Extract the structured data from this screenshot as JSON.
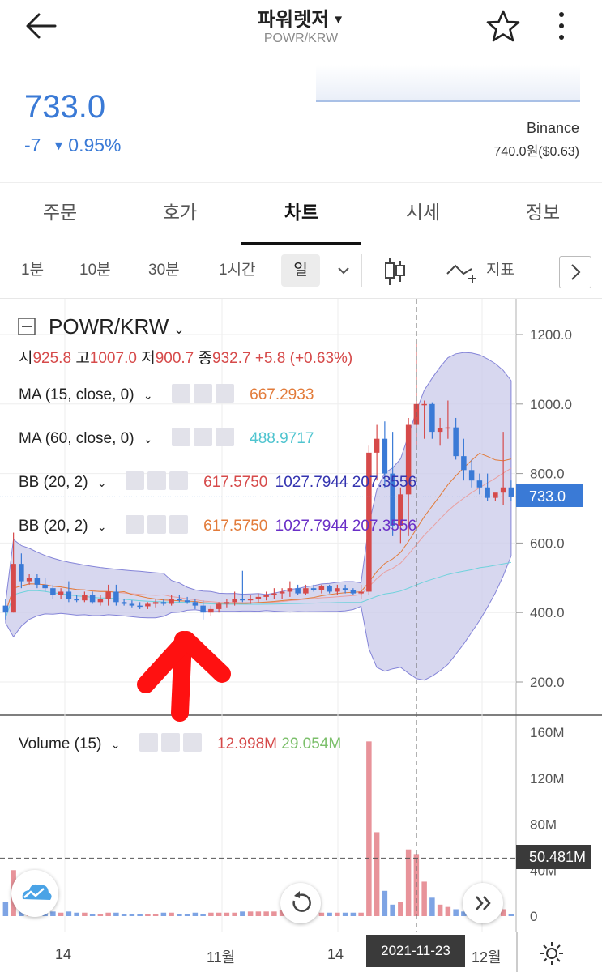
{
  "header": {
    "title": "파워렛저",
    "pair": "POWR/KRW"
  },
  "quote": {
    "price": "733.0",
    "change": "-7",
    "change_pct": "0.95%",
    "exchange": "Binance",
    "exchange_price": "740.0원($0.63)",
    "color_down": "#3a7ad6",
    "color_up": "#d64a4a"
  },
  "tabs": [
    "주문",
    "호가",
    "차트",
    "시세",
    "정보"
  ],
  "active_tab": "차트",
  "toolbar": {
    "intervals": [
      "1분",
      "10분",
      "30분",
      "1시간"
    ],
    "selected": "일",
    "indicator_label": "지표"
  },
  "legend": {
    "symbol": "POWR/KRW",
    "ohlc": {
      "o_label": "시",
      "o": "925.8",
      "h_label": "고",
      "h": "1007.0",
      "l_label": "저",
      "l": "900.7",
      "c_label": "종",
      "c": "932.7",
      "chg": "+5.8 (+0.63%)"
    },
    "ma15": {
      "label": "MA (15, close, 0)",
      "value": "667.2933",
      "color": "#e27b3a"
    },
    "ma60": {
      "label": "MA (60, close, 0)",
      "value": "488.9717",
      "color": "#4fc4cf"
    },
    "bb1": {
      "label": "BB (20, 2)",
      "mid": "617.5750",
      "upper": "1027.7944",
      "lower": "207.3556"
    },
    "bb2": {
      "label": "BB (20, 2)",
      "mid": "617.5750",
      "upper": "1027.7944",
      "lower": "207.3556"
    },
    "volume": {
      "label": "Volume (15)",
      "v1": "12.998M",
      "v2": "29.054M"
    }
  },
  "axes": {
    "price_ticks": [
      "1200.0",
      "1000.0",
      "800.0",
      "600.0",
      "400.0",
      "200.0"
    ],
    "price_current": "733.0",
    "volume_ticks": [
      "160M",
      "120M",
      "80M",
      "40M",
      "0"
    ],
    "volume_current": "50.481M",
    "x_ticks": [
      "14",
      "11월",
      "14",
      "12월"
    ],
    "crosshair_date": "2021-11-23"
  },
  "chart_data": {
    "type": "candlestick",
    "price_range": [
      100,
      1300
    ],
    "volume_range": [
      0,
      170
    ],
    "crosshair_price_line": 733.0,
    "volume_line": 50.481,
    "candles": [
      [
        420,
        440,
        380,
        400
      ],
      [
        400,
        630,
        400,
        540
      ],
      [
        540,
        570,
        470,
        490
      ],
      [
        490,
        510,
        480,
        500
      ],
      [
        500,
        510,
        470,
        480
      ],
      [
        480,
        500,
        460,
        470
      ],
      [
        470,
        480,
        440,
        450
      ],
      [
        450,
        470,
        440,
        460
      ],
      [
        460,
        490,
        430,
        440
      ],
      [
        440,
        450,
        430,
        435
      ],
      [
        435,
        460,
        430,
        450
      ],
      [
        450,
        460,
        425,
        430
      ],
      [
        430,
        450,
        420,
        440
      ],
      [
        440,
        480,
        420,
        460
      ],
      [
        460,
        480,
        420,
        430
      ],
      [
        430,
        440,
        420,
        425
      ],
      [
        425,
        435,
        415,
        420
      ],
      [
        420,
        430,
        410,
        418
      ],
      [
        418,
        430,
        410,
        425
      ],
      [
        425,
        440,
        415,
        430
      ],
      [
        430,
        440,
        420,
        425
      ],
      [
        425,
        450,
        420,
        440
      ],
      [
        440,
        450,
        430,
        435
      ],
      [
        435,
        445,
        425,
        430
      ],
      [
        430,
        440,
        410,
        420
      ],
      [
        420,
        435,
        380,
        400
      ],
      [
        400,
        420,
        390,
        410
      ],
      [
        410,
        430,
        400,
        425
      ],
      [
        425,
        440,
        415,
        430
      ],
      [
        430,
        460,
        420,
        440
      ],
      [
        440,
        520,
        430,
        435
      ],
      [
        435,
        450,
        425,
        440
      ],
      [
        440,
        455,
        430,
        445
      ],
      [
        445,
        460,
        435,
        450
      ],
      [
        450,
        470,
        440,
        455
      ],
      [
        455,
        470,
        440,
        460
      ],
      [
        460,
        490,
        445,
        470
      ],
      [
        470,
        480,
        450,
        455
      ],
      [
        455,
        480,
        450,
        470
      ],
      [
        470,
        480,
        460,
        465
      ],
      [
        465,
        480,
        455,
        475
      ],
      [
        475,
        480,
        455,
        460
      ],
      [
        460,
        480,
        450,
        470
      ],
      [
        470,
        480,
        455,
        465
      ],
      [
        465,
        470,
        450,
        455
      ],
      [
        455,
        480,
        440,
        460
      ],
      [
        460,
        880,
        450,
        860
      ],
      [
        860,
        940,
        780,
        900
      ],
      [
        900,
        950,
        760,
        800
      ],
      [
        800,
        920,
        620,
        650
      ],
      [
        650,
        760,
        600,
        740
      ],
      [
        740,
        960,
        620,
        940
      ],
      [
        940,
        1180,
        880,
        1000
      ],
      [
        1000,
        1010,
        900,
        1000
      ],
      [
        1000,
        1005,
        900,
        920
      ],
      [
        920,
        960,
        880,
        930
      ],
      [
        930,
        1010,
        900,
        932.7
      ],
      [
        932.7,
        960,
        840,
        850
      ],
      [
        850,
        900,
        780,
        810
      ],
      [
        810,
        840,
        760,
        780
      ],
      [
        780,
        800,
        740,
        760
      ],
      [
        760,
        800,
        720,
        730
      ],
      [
        730,
        740,
        720,
        745
      ],
      [
        745,
        920,
        710,
        760
      ],
      [
        760,
        780,
        720,
        733
      ]
    ],
    "volumes": [
      12,
      40,
      15,
      6,
      5,
      5,
      4,
      3,
      4,
      3,
      3,
      2,
      2,
      3,
      3,
      2,
      2,
      2,
      2,
      2,
      3,
      3,
      2,
      2,
      3,
      2,
      3,
      3,
      3,
      3,
      4,
      4,
      4,
      4,
      4,
      5,
      4,
      3,
      3,
      3,
      3,
      3,
      3,
      3,
      3,
      3,
      152,
      73,
      22,
      10,
      12,
      58,
      54,
      30,
      16,
      10,
      8,
      6,
      4,
      3,
      2,
      2,
      2,
      6,
      2
    ]
  }
}
